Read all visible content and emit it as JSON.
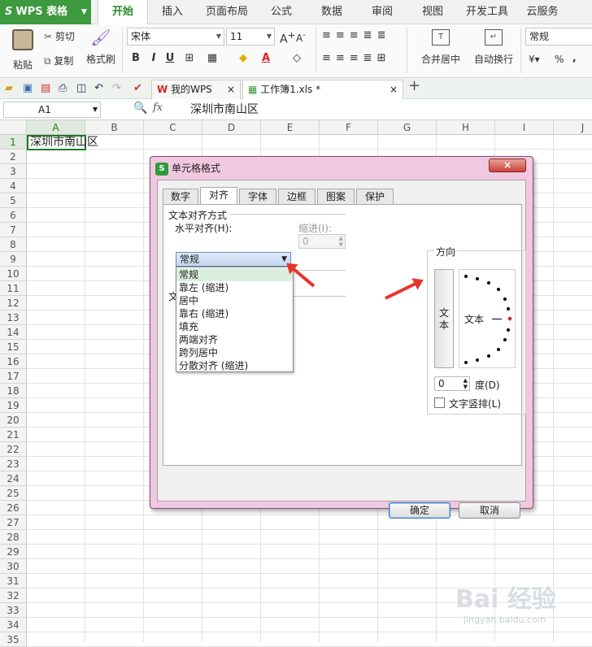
{
  "app": {
    "name": "WPS 表格",
    "dropdown_icon": "triangle-down"
  },
  "menu": {
    "tabs": [
      "开始",
      "插入",
      "页面布局",
      "公式",
      "数据",
      "审阅",
      "视图",
      "开发工具",
      "云服务"
    ],
    "active": "开始"
  },
  "ribbon": {
    "paste": "粘贴",
    "cut": "剪切",
    "copy": "复制",
    "format_painter": "格式刷",
    "font_name": "宋体",
    "font_size": "11",
    "merge_center": "合并居中",
    "wrap_text": "自动换行",
    "number_format": "常规",
    "percent": "%",
    "comma": ",",
    "bold": "B",
    "italic": "I",
    "underline": "U",
    "font_color": "A"
  },
  "tabs": {
    "items": [
      "我的WPS",
      "工作簿1.xls *"
    ],
    "close": "×",
    "add": "+"
  },
  "formula_bar": {
    "cell_ref": "A1",
    "fx": "fx",
    "content": "深圳市南山区"
  },
  "sheet": {
    "columns": [
      "A",
      "B",
      "C",
      "D",
      "E",
      "F",
      "G",
      "H",
      "I",
      "J"
    ],
    "rows": [
      "1",
      "2",
      "3",
      "4",
      "5",
      "6",
      "7",
      "8",
      "9",
      "10",
      "11",
      "12",
      "13",
      "14",
      "15",
      "16",
      "17",
      "18",
      "19",
      "20",
      "21",
      "22",
      "23",
      "24",
      "25",
      "26",
      "27",
      "28",
      "29",
      "30",
      "31",
      "32",
      "33",
      "34",
      "35"
    ],
    "a1_value": "深圳市南山区"
  },
  "dialog": {
    "title": "单元格格式",
    "close": "×",
    "tabs": [
      "数字",
      "对齐",
      "字体",
      "边框",
      "图案",
      "保护"
    ],
    "active_tab": "对齐",
    "group_title": "文本对齐方式",
    "halign_label": "水平对齐(H):",
    "halign_value": "常规",
    "indent_label": "缩进(I):",
    "indent_value": "0",
    "halign_options": [
      "常规",
      "靠左 (缩进)",
      "居中",
      "靠右 (缩进)",
      "填充",
      "两端对齐",
      "跨列居中",
      "分散对齐 (缩进)"
    ],
    "text_control_prefix": "文",
    "orientation_title": "方向",
    "orientation_vertical_text": "文本",
    "orientation_text": "文本",
    "degree_value": "0",
    "degree_label": "度(D)",
    "vertical_text_label": "文字竖排(L)",
    "ok": "确定",
    "cancel": "取消"
  },
  "watermark": {
    "brand": "Bai 经验",
    "url": "jingyan.baidu.com"
  }
}
